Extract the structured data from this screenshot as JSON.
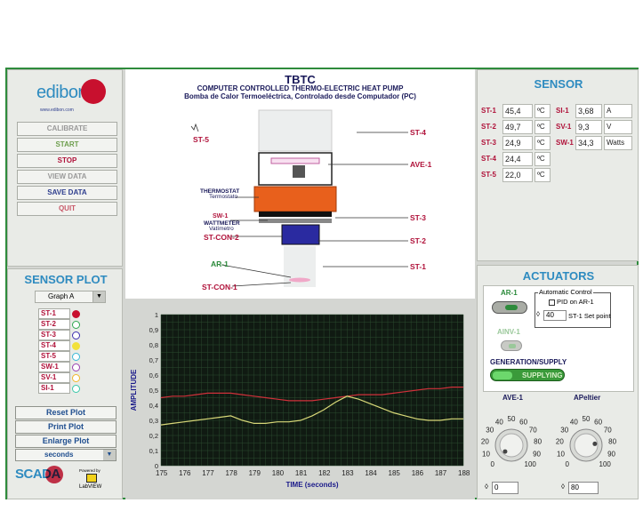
{
  "app": {
    "brand": "edibon",
    "brand_url": "www.edibon.com",
    "title": "TBTC",
    "subtitle_en": "COMPUTER CONTROLLED THERMO-ELECTRIC HEAT PUMP",
    "subtitle_es": "Bomba de Calor Termoeléctrica, Controlado desde Computador (PC)"
  },
  "controls": {
    "calibrate": "CALIBRATE",
    "start": "START",
    "stop": "STOP",
    "view_data": "VIEW DATA",
    "save_data": "SAVE DATA",
    "quit": "QUIT"
  },
  "sensor_plot": {
    "title": "SENSOR PLOT",
    "graph_select": "Graph A",
    "legend": [
      {
        "label": "ST-1",
        "color": "#c8102e",
        "filled": true
      },
      {
        "label": "ST-2",
        "color": "#2fa84f",
        "filled": false
      },
      {
        "label": "ST-3",
        "color": "#3d2fb0",
        "filled": false
      },
      {
        "label": "ST-4",
        "color": "#f2e13a",
        "filled": true
      },
      {
        "label": "ST-5",
        "color": "#38b8d8",
        "filled": false
      },
      {
        "label": "SW-1",
        "color": "#9b3fb0",
        "filled": false
      },
      {
        "label": "SV-1",
        "color": "#f2b82a",
        "filled": false
      },
      {
        "label": "SI-1",
        "color": "#38c8a8",
        "filled": false
      }
    ],
    "reset": "Reset Plot",
    "print": "Print Plot",
    "enlarge": "Enlarge Plot",
    "time_unit": "seconds"
  },
  "footer": {
    "scada": "SCADA",
    "powered": "Powered by",
    "labview": "LabVIEW"
  },
  "diagram": {
    "st5": "ST-5",
    "st4": "ST-4",
    "ave1": "AVE-1",
    "thermostat": "THERMOSTAT",
    "thermostat_es": "Termostato",
    "sw1": "SW-1",
    "wattmeter": "WATTMETER",
    "wattmeter_es": "Vatímetro",
    "st3": "ST-3",
    "stcon2": "ST-CON-2",
    "st2": "ST-2",
    "ar1": "AR-1",
    "st1": "ST-1",
    "stcon1": "ST-CON-1"
  },
  "chart_data": {
    "type": "line",
    "xlabel": "TIME  (seconds)",
    "ylabel": "AMPLITUDE",
    "xlim": [
      175,
      188
    ],
    "ylim": [
      0,
      1
    ],
    "x_ticks": [
      "175",
      "176",
      "177",
      "178",
      "179",
      "180",
      "181",
      "182",
      "183",
      "184",
      "185",
      "186",
      "187",
      "188"
    ],
    "y_ticks": [
      "0",
      "0,1",
      "0,2",
      "0,3",
      "0,4",
      "0,5",
      "0,6",
      "0,7",
      "0,8",
      "0,9",
      "1"
    ],
    "grid": true,
    "series": [
      {
        "color": "#d0303a",
        "x": [
          175,
          175.5,
          176,
          176.5,
          177,
          177.5,
          178,
          178.5,
          179,
          179.5,
          180,
          180.5,
          181,
          181.5,
          182,
          182.5,
          183,
          183.5,
          184,
          184.5,
          185,
          185.5,
          186,
          186.5,
          187,
          187.5,
          188
        ],
        "y": [
          0.45,
          0.46,
          0.46,
          0.47,
          0.48,
          0.48,
          0.48,
          0.47,
          0.46,
          0.45,
          0.44,
          0.43,
          0.43,
          0.43,
          0.44,
          0.45,
          0.46,
          0.47,
          0.47,
          0.47,
          0.48,
          0.49,
          0.5,
          0.51,
          0.51,
          0.52,
          0.52
        ]
      },
      {
        "color": "#d8d878",
        "x": [
          175,
          175.5,
          176,
          176.5,
          177,
          177.5,
          178,
          178.5,
          179,
          179.5,
          180,
          180.5,
          181,
          181.5,
          182,
          182.5,
          183,
          183.5,
          184,
          184.5,
          185,
          185.5,
          186,
          186.5,
          187,
          187.5,
          188
        ],
        "y": [
          0.27,
          0.28,
          0.29,
          0.3,
          0.31,
          0.32,
          0.33,
          0.3,
          0.28,
          0.28,
          0.29,
          0.29,
          0.3,
          0.33,
          0.37,
          0.42,
          0.46,
          0.44,
          0.41,
          0.38,
          0.35,
          0.33,
          0.31,
          0.3,
          0.3,
          0.31,
          0.31
        ]
      }
    ]
  },
  "sensor": {
    "title": "SENSOR",
    "rows": [
      {
        "label": "ST-1",
        "value": "45,4",
        "unit": "ºC"
      },
      {
        "label": "ST-2",
        "value": "49,7",
        "unit": "ºC"
      },
      {
        "label": "ST-3",
        "value": "24,9",
        "unit": "ºC"
      },
      {
        "label": "ST-4",
        "value": "24,4",
        "unit": "ºC"
      },
      {
        "label": "ST-5",
        "value": "22,0",
        "unit": "ºC"
      }
    ],
    "rows2": [
      {
        "label": "SI-1",
        "value": "3,68",
        "unit": "A"
      },
      {
        "label": "SV-1",
        "value": "9,3",
        "unit": "V"
      },
      {
        "label": "SW-1",
        "value": "34,3",
        "unit": "Watts"
      }
    ]
  },
  "actuators": {
    "title": "ACTUATORS",
    "ar1": "AR-1",
    "auto_control": "Automatic Control",
    "pid": "PID on AR-1",
    "setpoint_value": "40",
    "setpoint_label": "ST-1 Set point",
    "ainv1": "AINV-1",
    "gen_supply": "GENERATION/SUPPLY",
    "supplying": "SUPPLYING",
    "ave1": {
      "label": "AVE-1",
      "value": "0",
      "level": 0
    },
    "apeltier": {
      "label": "APeltier",
      "value": "80",
      "level": 80
    }
  }
}
